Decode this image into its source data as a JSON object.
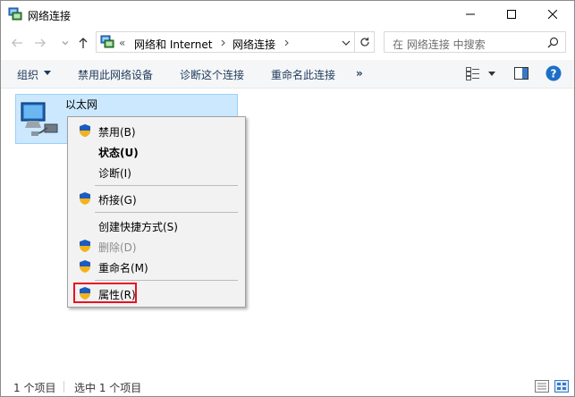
{
  "window": {
    "title": "网络连接",
    "minimize_icon": "minimize-icon",
    "maximize_icon": "maximize-icon",
    "close_icon": "close-icon"
  },
  "nav": {
    "address_prefix": "«",
    "crumbs": [
      "网络和 Internet",
      "网络连接"
    ],
    "search_placeholder": "在 网络连接 中搜索"
  },
  "commands": {
    "organize": "组织",
    "disable_device": "禁用此网络设备",
    "diagnose": "诊断这个连接",
    "rename": "重命名此连接",
    "more": "»"
  },
  "connection": {
    "name": "以太网"
  },
  "context_menu": {
    "items": [
      {
        "label": "禁用(B)",
        "shield": true
      },
      {
        "label": "状态(U)",
        "bold": true
      },
      {
        "label": "诊断(I)"
      },
      {
        "label": "桥接(G)",
        "shield": true
      },
      {
        "label": "创建快捷方式(S)"
      },
      {
        "label": "删除(D)",
        "shield": true,
        "disabled": true
      },
      {
        "label": "重命名(M)",
        "shield": true
      },
      {
        "label": "属性(R)",
        "shield": true,
        "highlighted": true
      }
    ]
  },
  "status": {
    "item_count": "1 个项目",
    "selected": "选中 1 个项目"
  },
  "colors": {
    "accent": "#0078d7",
    "selection_bg": "#cce8ff",
    "highlight_box": "#e81123"
  }
}
